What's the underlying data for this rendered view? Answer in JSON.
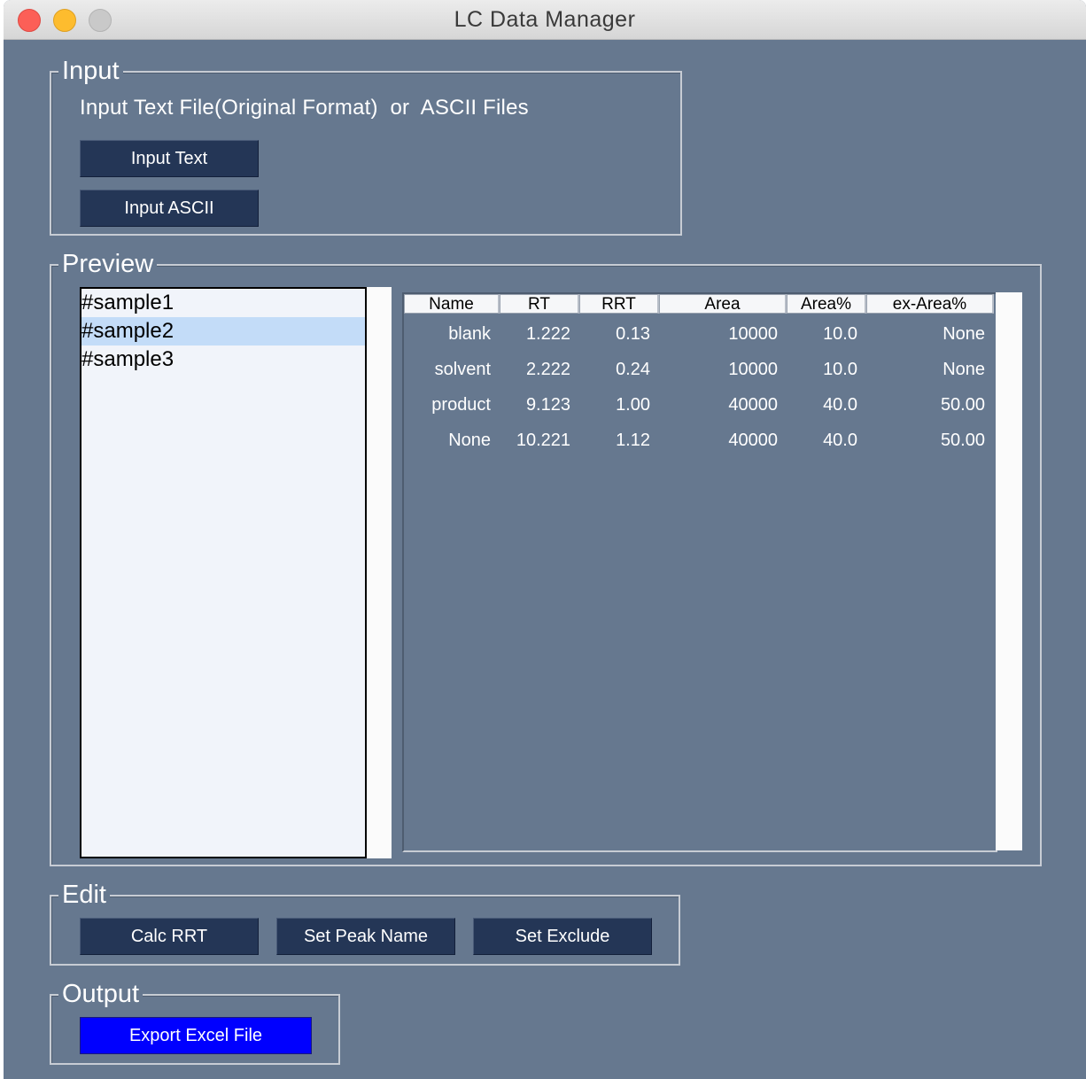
{
  "window": {
    "title": "LC Data Manager"
  },
  "input": {
    "legend": "Input",
    "label": "Input Text File(Original Format)  or  ASCII Files",
    "input_text_button": "Input Text",
    "input_ascii_button": "Input ASCII"
  },
  "preview": {
    "legend": "Preview",
    "samples": [
      "#sample1",
      "#sample2",
      "#sample3"
    ],
    "selected_sample": "#sample2",
    "table": {
      "columns": [
        "Name",
        "RT",
        "RRT",
        "Area",
        "Area%",
        "ex-Area%"
      ],
      "rows": [
        [
          "blank",
          "1.222",
          "0.13",
          "10000",
          "10.0",
          "None"
        ],
        [
          "solvent",
          "2.222",
          "0.24",
          "10000",
          "10.0",
          "None"
        ],
        [
          "product",
          "9.123",
          "1.00",
          "40000",
          "40.0",
          "50.00"
        ],
        [
          "None",
          "10.221",
          "1.12",
          "40000",
          "40.0",
          "50.00"
        ]
      ]
    }
  },
  "edit": {
    "legend": "Edit",
    "calc_rrt_button": "Calc RRT",
    "set_peak_name_button": "Set Peak Name",
    "set_exclude_button": "Set Exclude"
  },
  "output": {
    "legend": "Output",
    "export_button": "Export Excel File"
  },
  "colors": {
    "background": "#66788f",
    "button": "#243656",
    "export_button": "#0000ff",
    "selection": "#c3dcf8"
  }
}
